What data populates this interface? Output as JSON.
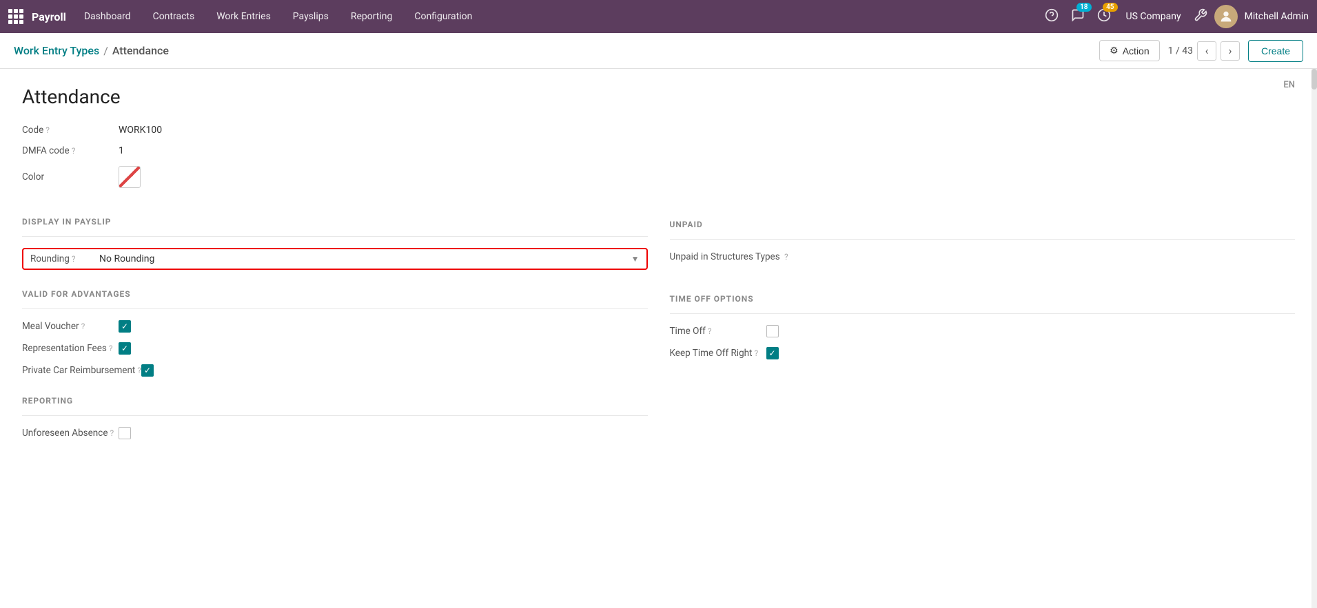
{
  "app": {
    "name": "Payroll"
  },
  "nav": {
    "items": [
      {
        "label": "Dashboard",
        "id": "dashboard"
      },
      {
        "label": "Contracts",
        "id": "contracts"
      },
      {
        "label": "Work Entries",
        "id": "work-entries"
      },
      {
        "label": "Payslips",
        "id": "payslips"
      },
      {
        "label": "Reporting",
        "id": "reporting"
      },
      {
        "label": "Configuration",
        "id": "configuration"
      }
    ],
    "messages_count": "18",
    "alerts_count": "45",
    "company": "US Company",
    "username": "Mitchell Admin"
  },
  "breadcrumb": {
    "parent": "Work Entry Types",
    "separator": "/",
    "current": "Attendance"
  },
  "toolbar": {
    "action_label": "⚙ Action",
    "pager": "1 / 43",
    "create_label": "Create"
  },
  "record": {
    "title": "Attendance",
    "lang": "EN",
    "fields": {
      "code_label": "Code",
      "code_value": "WORK100",
      "dmfa_label": "DMFA code",
      "dmfa_value": "1",
      "color_label": "Color"
    },
    "display_in_payslip": {
      "section_label": "DISPLAY IN PAYSLIP",
      "rounding_label": "Rounding",
      "rounding_help": "?",
      "rounding_value": "No Rounding"
    },
    "unpaid": {
      "section_label": "UNPAID",
      "unpaid_structures_label": "Unpaid in Structures Types",
      "unpaid_structures_help": "?"
    },
    "valid_for_advantages": {
      "section_label": "VALID FOR ADVANTAGES",
      "meal_voucher_label": "Meal Voucher",
      "meal_voucher_help": "?",
      "meal_voucher_checked": true,
      "representation_fees_label": "Representation Fees",
      "representation_fees_help": "?",
      "representation_fees_checked": true,
      "private_car_label": "Private Car Reimbursement",
      "private_car_help": "?",
      "private_car_checked": true
    },
    "time_off_options": {
      "section_label": "TIME OFF OPTIONS",
      "time_off_label": "Time Off",
      "time_off_help": "?",
      "time_off_checked": false,
      "keep_time_off_label": "Keep Time Off Right",
      "keep_time_off_help": "?",
      "keep_time_off_checked": true
    },
    "reporting": {
      "section_label": "REPORTING",
      "unforeseen_absence_label": "Unforeseen Absence",
      "unforeseen_absence_help": "?",
      "unforeseen_absence_checked": false
    }
  }
}
